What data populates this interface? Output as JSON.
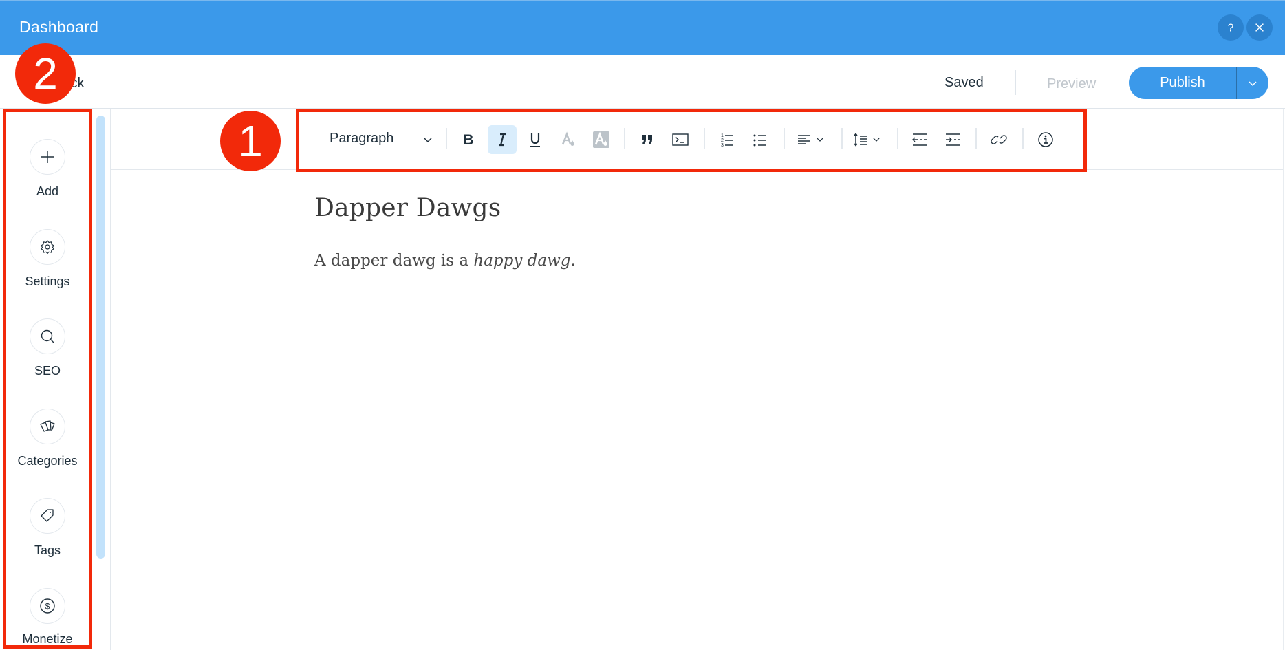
{
  "header": {
    "title": "Dashboard",
    "help_icon": "question-mark-icon",
    "close_icon": "close-icon"
  },
  "subbar": {
    "back_label": "Back",
    "status": "Saved",
    "preview_label": "Preview",
    "publish_label": "Publish"
  },
  "sidebar": {
    "items": [
      {
        "label": "Add",
        "icon": "plus-icon"
      },
      {
        "label": "Settings",
        "icon": "gear-icon"
      },
      {
        "label": "SEO",
        "icon": "search-icon"
      },
      {
        "label": "Categories",
        "icon": "cards-icon"
      },
      {
        "label": "Tags",
        "icon": "tag-icon"
      },
      {
        "label": "Monetize",
        "icon": "dollar-icon"
      }
    ]
  },
  "toolbar": {
    "paragraph_style": "Paragraph",
    "buttons": [
      "bold",
      "italic",
      "underline",
      "text-color",
      "highlight",
      "blockquote",
      "code-block",
      "numbered-list",
      "bulleted-list",
      "text-align",
      "line-spacing",
      "decrease-indent",
      "increase-indent",
      "link",
      "info"
    ],
    "active": "italic"
  },
  "editor": {
    "title": "Dapper Dawgs",
    "body_plain": "A dapper dawg is a ",
    "body_italic": "happy dawg",
    "body_end": "."
  },
  "annotations": {
    "badge_1": "1",
    "badge_2": "2",
    "color": "#f2290a"
  },
  "colors": {
    "brand": "#3b99ea",
    "active_bg": "#d9edfc"
  }
}
